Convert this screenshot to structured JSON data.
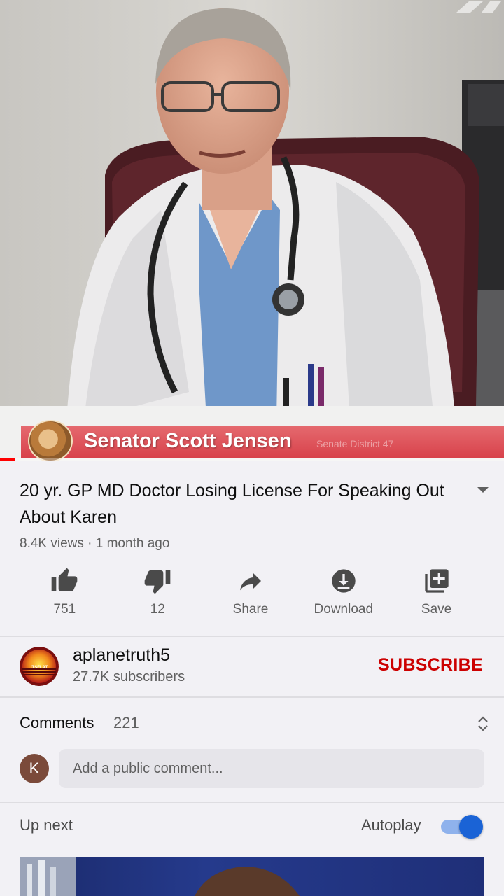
{
  "video": {
    "lower_third_name": "Senator Scott Jensen",
    "lower_third_sub": "Senate District 47",
    "progress_fraction": 0.03
  },
  "title": "20 yr. GP MD Doctor Losing License For Speaking Out About Karen",
  "meta": "8.4K views · 1 month ago",
  "actions": {
    "like_count": "751",
    "dislike_count": "12",
    "share_label": "Share",
    "download_label": "Download",
    "save_label": "Save"
  },
  "channel": {
    "name": "aplanetruth5",
    "subscribers": "27.7K subscribers",
    "avatar_text": "ITSFLAT",
    "subscribe_label": "SUBSCRIBE"
  },
  "comments": {
    "title": "Comments",
    "count": "221",
    "user_initial": "K",
    "placeholder": "Add a public comment..."
  },
  "up_next": {
    "label": "Up next",
    "autoplay_label": "Autoplay",
    "autoplay_on": true
  },
  "colors": {
    "accent_red": "#cc0000",
    "toggle_blue": "#1a63d6",
    "progress_red": "#ff0000"
  },
  "icons": [
    "thumbs-up-icon",
    "thumbs-down-icon",
    "share-icon",
    "download-icon",
    "save-playlist-icon",
    "expand-chevron-icon",
    "sort-icon"
  ]
}
